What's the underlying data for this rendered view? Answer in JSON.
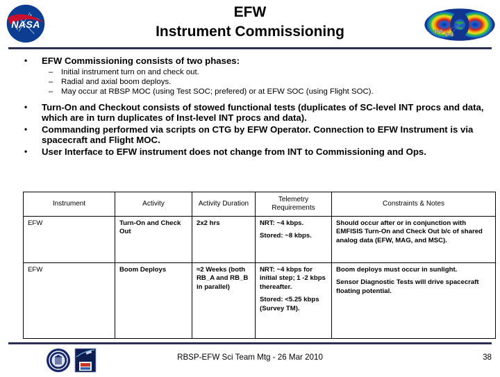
{
  "header": {
    "title_line1": "EFW",
    "title_line2": "Instrument Commissioning",
    "nasa_logo_alt": "NASA",
    "nasa_wordmark": "NASA",
    "rbsp_graphic_alt": "radiation-belt-torus"
  },
  "content": {
    "bullets": [
      {
        "marker": "•",
        "text": "EFW Commissioning consists of two phases:",
        "subs": [
          {
            "marker": "–",
            "text": "Initial instrument turn on and check out."
          },
          {
            "marker": "–",
            "text": "Radial and axial boom deploys."
          },
          {
            "marker": "–",
            "text": "May occur at RBSP MOC (using Test SOC; prefered) or at EFW SOC (using Flight SOC)."
          }
        ]
      },
      {
        "marker": "•",
        "text": "Turn-On and Checkout consists of stowed functional tests (duplicates of SC-level  INT procs and data, which are in turn duplicates of Inst-level INT procs and data).",
        "subs": []
      },
      {
        "marker": "•",
        "text": "Commanding performed via scripts on CTG by EFW Operator.  Connection to EFW Instrument is via spacecraft and Flight MOC.",
        "subs": []
      },
      {
        "marker": "•",
        "text": "User Interface to EFW instrument does not change from INT to Commissioning and Ops.",
        "subs": []
      }
    ]
  },
  "table": {
    "headers": [
      "Instrument",
      "Activity",
      "Activity Duration",
      "Telemetry Requirements",
      "Constraints & Notes"
    ],
    "rows": [
      {
        "instrument": "EFW",
        "activity": "Turn-On and Check Out",
        "duration": "2x2 hrs",
        "telemetry_1": "NRT: ~4 kbps.",
        "telemetry_2": "Stored: ~8 kbps.",
        "notes_1": "Should occur after or in conjunction with EMFISIS Turn-On and Check Out b/c of shared analog data (EFW, MAG, and MSC).",
        "notes_2": ""
      },
      {
        "instrument": "EFW",
        "activity": "Boom Deploys",
        "duration": "≈2 Weeks (both RB_A and RB_B in parallel)",
        "telemetry_1": "NRT: ~4 kbps for initial step; 1 -2 kbps thereafter.",
        "telemetry_2": "Stored: <5.25 kbps (Survey TM).",
        "notes_1": "Boom deploys must occur in sunlight.",
        "notes_2": "Sensor Diagnostic Tests will drive spacecraft floating potential."
      }
    ]
  },
  "footer": {
    "text": "RBSP-EFW Sci Team Mtg - 26 Mar 2010",
    "page_number": "38",
    "seal_logo_alt": "university-seal",
    "mission_patch_alt": "rbsp-mission-patch"
  },
  "colors": {
    "rule": "#2b2f52",
    "text": "#000000",
    "background": "#ffffff",
    "nasa_blue": "#0b3d91",
    "nasa_red": "#c8102e"
  }
}
